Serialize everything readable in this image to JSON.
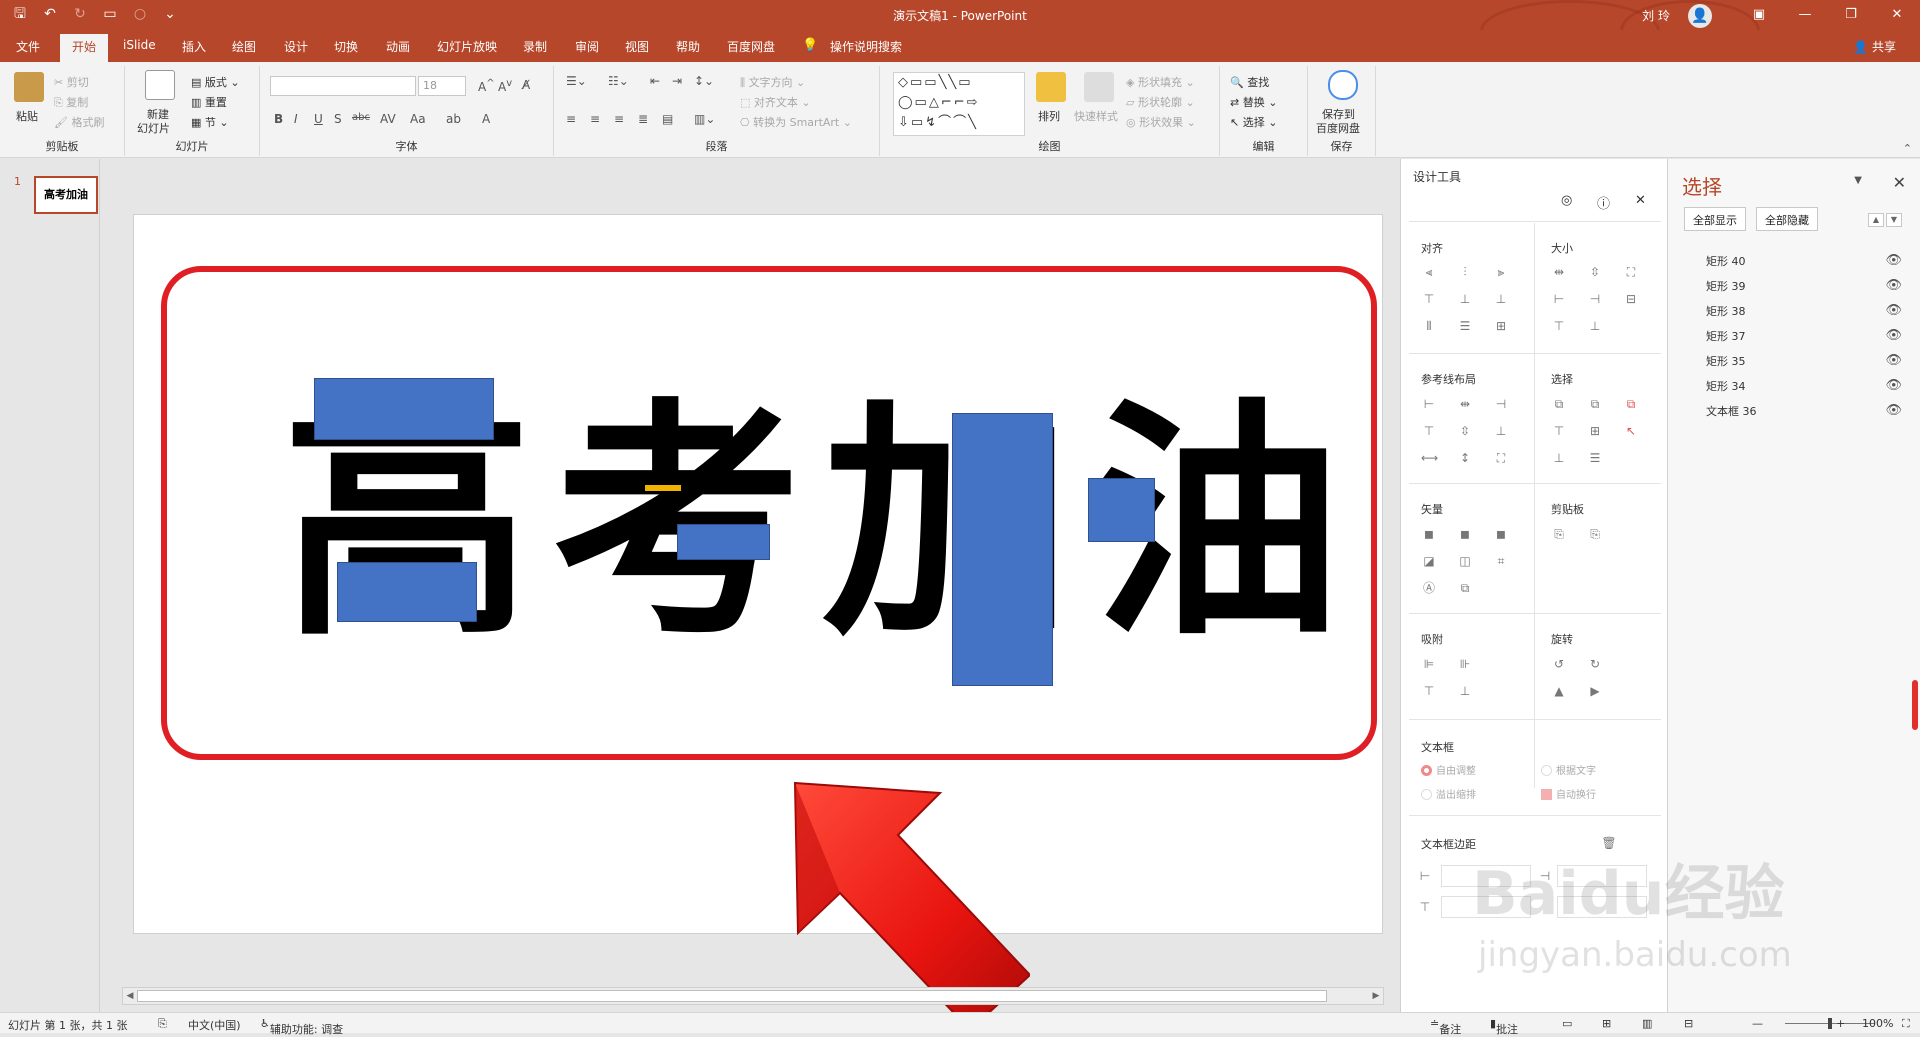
{
  "window": {
    "doc_title": "演示文稿1  -  PowerPoint",
    "user": "刘 玲",
    "share": "共享",
    "tell_me": "操作说明搜索"
  },
  "tabs": [
    "文件",
    "开始",
    "iSlide",
    "插入",
    "绘图",
    "设计",
    "切换",
    "动画",
    "幻灯片放映",
    "录制",
    "审阅",
    "视图",
    "帮助",
    "百度网盘"
  ],
  "active_tab": "开始",
  "ribbon": {
    "clipboard": {
      "label": "剪贴板",
      "paste": "粘贴",
      "cut": "剪切",
      "copy": "复制",
      "format_painter": "格式刷"
    },
    "slides": {
      "label": "幻灯片",
      "new_slide_1": "新建",
      "new_slide_2": "幻灯片",
      "layout": "版式",
      "reset": "重置",
      "section": "节"
    },
    "font": {
      "label": "字体",
      "size": "18"
    },
    "paragraph": {
      "label": "段落",
      "text_direction": "文字方向",
      "align_text": "对齐文本",
      "smartart": "转换为 SmartArt"
    },
    "drawing": {
      "label": "绘图",
      "arrange": "排列",
      "quick_styles": "快速样式",
      "shape_fill": "形状填充",
      "shape_outline": "形状轮廓",
      "shape_effects": "形状效果"
    },
    "editing": {
      "label": "编辑",
      "find": "查找",
      "replace": "替换",
      "select": "选择"
    },
    "save": {
      "label": "保存",
      "save_to_1": "保存到",
      "save_to_2": "百度网盘"
    }
  },
  "thumbnail": {
    "number": "1",
    "text": "高考加油"
  },
  "slide": {
    "text": "高考加油"
  },
  "design_tools": {
    "title": "设计工具",
    "align": "对齐",
    "size": "大小",
    "guide_layout": "参考线布局",
    "select": "选择",
    "vector": "矢量",
    "clipboard": "剪贴板",
    "snap": "吸附",
    "rotate": "旋转",
    "textbox": "文本框",
    "autofit": "自由调整",
    "fit_text": "根据文字",
    "overflow": "溢出缩排",
    "wrap": "自动换行",
    "margin": "文本框边距"
  },
  "selection_pane": {
    "title": "选择",
    "show_all": "全部显示",
    "hide_all": "全部隐藏",
    "items": [
      "矩形 40",
      "矩形 39",
      "矩形 38",
      "矩形 37",
      "矩形 35",
      "矩形 34",
      "文本框 36"
    ]
  },
  "status": {
    "slide_count": "幻灯片 第 1 张，共 1 张",
    "language": "中文(中国)",
    "accessibility": "辅助功能: 调查",
    "notes": "备注",
    "comments": "批注",
    "zoom": "100%"
  },
  "watermark": {
    "line1": "Baidu经验",
    "line2": "jingyan.baidu.com"
  },
  "colors": {
    "accent": "#b7472a",
    "frame": "#e01f25",
    "shape_fill": "#4472c4",
    "arrow": "#e8140f"
  }
}
